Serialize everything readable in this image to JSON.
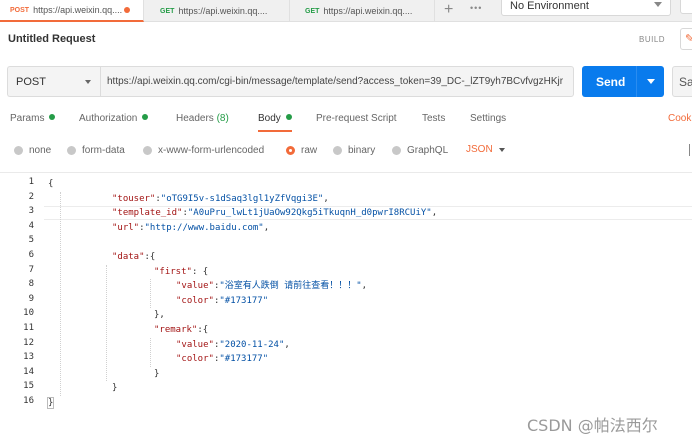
{
  "tabs": [
    {
      "method": "POST",
      "label": "https://api.weixin.qq....",
      "active": true,
      "unsaved": true
    },
    {
      "method": "GET",
      "label": "https://api.weixin.qq...."
    },
    {
      "method": "GET",
      "label": "https://api.weixin.qq...."
    }
  ],
  "environment": "No Environment",
  "request": {
    "title": "Untitled Request",
    "build_label": "BUILD",
    "method": "POST",
    "url": "https://api.weixin.qq.com/cgi-bin/message/template/send?access_token=39_DC-_lZT9yh7BCvfvgzHKjr",
    "send_label": "Send",
    "save_label": "Sa"
  },
  "subtabs": {
    "params": "Params",
    "authorization": "Authorization",
    "headers": "Headers",
    "headers_count": "(8)",
    "body": "Body",
    "prerequest": "Pre-request Script",
    "tests": "Tests",
    "settings": "Settings",
    "cookies": "Cook"
  },
  "body_options": {
    "none": "none",
    "form_data": "form-data",
    "urlencoded": "x-www-form-urlencoded",
    "raw": "raw",
    "binary": "binary",
    "graphql": "GraphQL",
    "format": "JSON",
    "selected": "raw"
  },
  "code": {
    "line_numbers": [
      "1",
      "2",
      "3",
      "4",
      "5",
      "6",
      "7",
      "8",
      "9",
      "10",
      "11",
      "12",
      "13",
      "14",
      "15",
      "16"
    ],
    "lines": [
      {
        "indent": 0,
        "parts": [
          [
            "p",
            "{"
          ]
        ]
      },
      {
        "indent": 1,
        "parts": [
          [
            "k",
            "\"touser\""
          ],
          [
            "p",
            ":"
          ],
          [
            "v",
            "\"oTG9I5v-s1dSaq3lgl1yZfVqgi3E\""
          ],
          [
            "p",
            ","
          ]
        ]
      },
      {
        "indent": 1,
        "parts": [
          [
            "k",
            "\"template_id\""
          ],
          [
            "p",
            ":"
          ],
          [
            "v",
            "\"A0uPru_lwLt1jUaOw92Qkg5iTkuqnH_d0pwrI8RCUiY\""
          ],
          [
            "p",
            ","
          ]
        ]
      },
      {
        "indent": 1,
        "parts": [
          [
            "k",
            "\"url\""
          ],
          [
            "p",
            ":"
          ],
          [
            "v",
            "\"http://www.baidu.com\""
          ],
          [
            "p",
            ","
          ]
        ]
      },
      {
        "indent": 1,
        "parts": []
      },
      {
        "indent": 1,
        "parts": [
          [
            "k",
            "\"data\""
          ],
          [
            "p",
            ":{"
          ]
        ]
      },
      {
        "indent": 2,
        "parts": [
          [
            "k",
            "\"first\""
          ],
          [
            "p",
            ": {"
          ]
        ]
      },
      {
        "indent": 3,
        "parts": [
          [
            "k",
            "\"value\""
          ],
          [
            "p",
            ":"
          ],
          [
            "v",
            "\"浴室有人跌倒 请前往查看！！！\""
          ],
          [
            "p",
            ","
          ]
        ]
      },
      {
        "indent": 3,
        "parts": [
          [
            "k",
            "\"color\""
          ],
          [
            "p",
            ":"
          ],
          [
            "v",
            "\"#173177\""
          ]
        ]
      },
      {
        "indent": 2,
        "parts": [
          [
            "p",
            "},"
          ]
        ]
      },
      {
        "indent": 2,
        "parts": [
          [
            "k",
            "\"remark\""
          ],
          [
            "p",
            ":{"
          ]
        ]
      },
      {
        "indent": 3,
        "parts": [
          [
            "k",
            "\"value\""
          ],
          [
            "p",
            ":"
          ],
          [
            "v",
            "\"2020-11-24\""
          ],
          [
            "p",
            ","
          ]
        ]
      },
      {
        "indent": 3,
        "parts": [
          [
            "k",
            "\"color\""
          ],
          [
            "p",
            ":"
          ],
          [
            "v",
            "\"#173177\""
          ]
        ]
      },
      {
        "indent": 2,
        "parts": [
          [
            "p",
            "}"
          ]
        ]
      },
      {
        "indent": 1,
        "parts": [
          [
            "p",
            "}"
          ]
        ]
      },
      {
        "indent": 0,
        "parts": [
          [
            "p",
            "}"
          ]
        ]
      }
    ]
  },
  "watermark": "CSDN @帕法西尔",
  "colors": {
    "accent": "#f26b3a",
    "send": "#097bed",
    "key": "#a31515",
    "string": "#0451a5",
    "success": "#249c47"
  }
}
